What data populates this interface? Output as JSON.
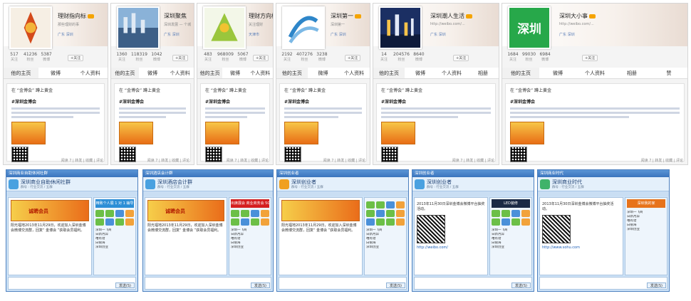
{
  "weibo_panels": [
    {
      "name": "理财指向标",
      "subtitle": "那些理财的事",
      "location": "广东 深圳",
      "stats": [
        {
          "v": "517",
          "l": "关注"
        },
        {
          "v": "41236",
          "l": "粉丝"
        },
        {
          "v": "5387",
          "l": "微博"
        }
      ],
      "follow": "+关注",
      "tabs": [
        "他的主页",
        "微博",
        "个人资料"
      ],
      "repost": "在 “金博会” 蹲上黄金",
      "post_title": "#深圳金博会",
      "footer": "阅读 7 | 转发 | 收藏 | 评论",
      "avatar_color": "#e6c79a"
    },
    {
      "name": "深圳聚焦",
      "subtitle": "深圳发展 — 个城",
      "location": "广东 深圳",
      "stats": [
        {
          "v": "1360",
          "l": "关注"
        },
        {
          "v": "118319",
          "l": "粉丝"
        },
        {
          "v": "1042",
          "l": "微博"
        }
      ],
      "follow": "+关注",
      "tabs": [
        "他的主页",
        "微博",
        "个人资料"
      ],
      "repost": "在 “金博会” 蹲上黄金",
      "post_title": "#深圳金博会",
      "footer": "阅读 7 | 转发 | 收藏 | 评论",
      "avatar_color": "#4d6f9b"
    },
    {
      "name": "理财方向标",
      "subtitle": "关注理财",
      "location": "天津市",
      "stats": [
        {
          "v": "483",
          "l": "关注"
        },
        {
          "v": "968009",
          "l": "粉丝"
        },
        {
          "v": "5067",
          "l": "微博"
        }
      ],
      "follow": "+关注",
      "tabs": [
        "他的主页",
        "微博",
        "个人资料"
      ],
      "repost": "在 “金博会” 蹲上黄金",
      "post_title": "#深圳金博会",
      "footer": "阅读 7 | 转发 | 收藏 | 评论",
      "avatar_color": "#9ac63c"
    },
    {
      "name": "深圳第一",
      "subtitle": "深圳第一",
      "location": "广东 深圳",
      "stats": [
        {
          "v": "2192",
          "l": "关注"
        },
        {
          "v": "407276",
          "l": "粉丝"
        },
        {
          "v": "3238",
          "l": "微博"
        }
      ],
      "follow": "+关注",
      "tabs": [
        "他的主页",
        "微博",
        "个人资料"
      ],
      "repost": "在 “金博会” 蹲上黄金",
      "post_title": "#深圳金博会",
      "footer": "阅读 7 | 转发 | 收藏 | 评论",
      "avatar_color": "#2e86c9"
    },
    {
      "name": "深圳潮人生活",
      "subtitle": "http://weibo.com/...",
      "location": "广东 深圳",
      "stats": [
        {
          "v": "14",
          "l": "关注"
        },
        {
          "v": "204576",
          "l": "粉丝"
        },
        {
          "v": "8640",
          "l": "微博"
        }
      ],
      "follow": "+关注",
      "tabs": [
        "他的主页",
        "微博",
        "个人资料",
        "相册"
      ],
      "repost": "在 “金博会” 蹲上黄金",
      "post_title": "#深圳金博会",
      "footer": "阅读 7 | 转发 | 收藏 | 评论",
      "avatar_color": "#243f7a"
    },
    {
      "name": "深圳大小事",
      "subtitle": "http://weibo.com/...",
      "location": "广东 深圳",
      "stats": [
        {
          "v": "1684",
          "l": "关注"
        },
        {
          "v": "99030",
          "l": "粉丝"
        },
        {
          "v": "6984",
          "l": "微博"
        }
      ],
      "follow": "+关注",
      "tabs": [
        "他的主页",
        "微博",
        "个人资料",
        "相册",
        "赞"
      ],
      "repost": "在 “金博会” 蹲上黄金",
      "post_title": "#深圳金博会",
      "footer": "阅读 7 | 转发 | 收藏 | 评论",
      "avatar_color": "#27a84a",
      "avatar_text": "深圳"
    }
  ],
  "qq_windows": [
    {
      "title": "深圳商业自助休闲社群",
      "group": "深圳商业自助休闲社群",
      "sub": "群号 : 行业交流 / 五群",
      "banner": "诚聘会员",
      "banner_style": "orange",
      "msg": "阳光福地2013年11月29日，欢迎加入深圳金博会微博交流群，回复“ 金博会 ”获取会员福利。",
      "ad": "精致个人展 1 对 1 辅导",
      "members": [
        "深圳一飞商",
        "日新月异",
        "唯有谱",
        "白银海",
        "深圳创业"
      ],
      "send": "发送(S)"
    },
    {
      "title": "深圳酒店会计群",
      "group": "深圳酒店会计群",
      "sub": "群号 : 行业交流 / 五群",
      "banner": "诚聘会员",
      "banner_style": "orange",
      "msg": "阳光福地2013年11月29日，欢迎加入深圳金博会微博交流群，回复“ 金博会 ”获取会员福利。",
      "ad": "出席展会 商业商务会 5G万人上赚钱",
      "members": [
        "深圳一飞商",
        "日新月异",
        "唯有谱",
        "白银海",
        "深圳创业"
      ],
      "send": "发送(S)"
    },
    {
      "title": "深圳创业者",
      "group": "深圳创业者",
      "sub": "群号 : 行业交流 / 五群",
      "banner": "",
      "banner_style": "red",
      "msg": "阳光福地2013年11月29日，欢迎加入深圳金博会微博交流群，回复“ 金博会 ”获取会员福利。",
      "ad": "",
      "members": [
        "深圳一飞商",
        "日新月异",
        "唯有谱",
        "白银海",
        "深圳创业"
      ],
      "send": "发送(S)"
    },
    {
      "title": "深圳创业者",
      "group": "深圳创业者",
      "sub": "群号 : 行业交流 / 五群",
      "banner": "",
      "banner_style": "red",
      "msg": "2013年11月30日深圳金博会微博平台抽奖活动。",
      "ad": "LED装修",
      "members": [
        "深圳一飞商",
        "日新月异",
        "唯有谱",
        "白银海",
        "深圳创业"
      ],
      "url": "http://weibo.com/",
      "send": "发送(S)"
    },
    {
      "title": "深圳商业时代",
      "group": "深圳商业时代",
      "sub": "群号 : 行业交流 / 五群",
      "banner": "",
      "banner_style": "red",
      "msg": "2013年11月30日深圳金博会微博平台抽奖活动。",
      "ad": "深圳我的家",
      "members": [
        "深圳一飞商",
        "日新月异",
        "唯有谱",
        "白银海",
        "深圳创业"
      ],
      "url": "http://www.sohu.com",
      "send": "发送(S)"
    }
  ]
}
